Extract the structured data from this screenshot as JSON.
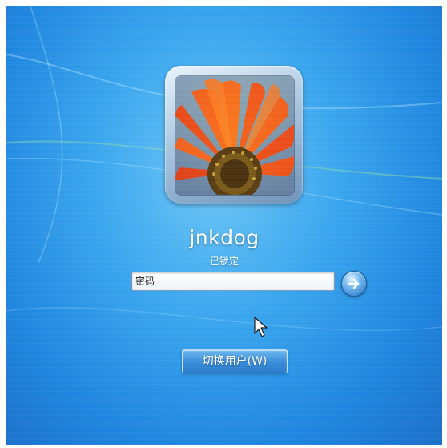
{
  "user": {
    "name": "jnkdog",
    "status": "已锁定"
  },
  "password": {
    "placeholder": "密码",
    "value": ""
  },
  "buttons": {
    "submit_icon": "arrow-right-icon",
    "switch_user_label": "切换用户(W)"
  },
  "colors": {
    "background": "#2a93e6",
    "accent": "#1e6fc4",
    "text": "#ffffff"
  },
  "avatar": {
    "subject": "orange-flower"
  }
}
